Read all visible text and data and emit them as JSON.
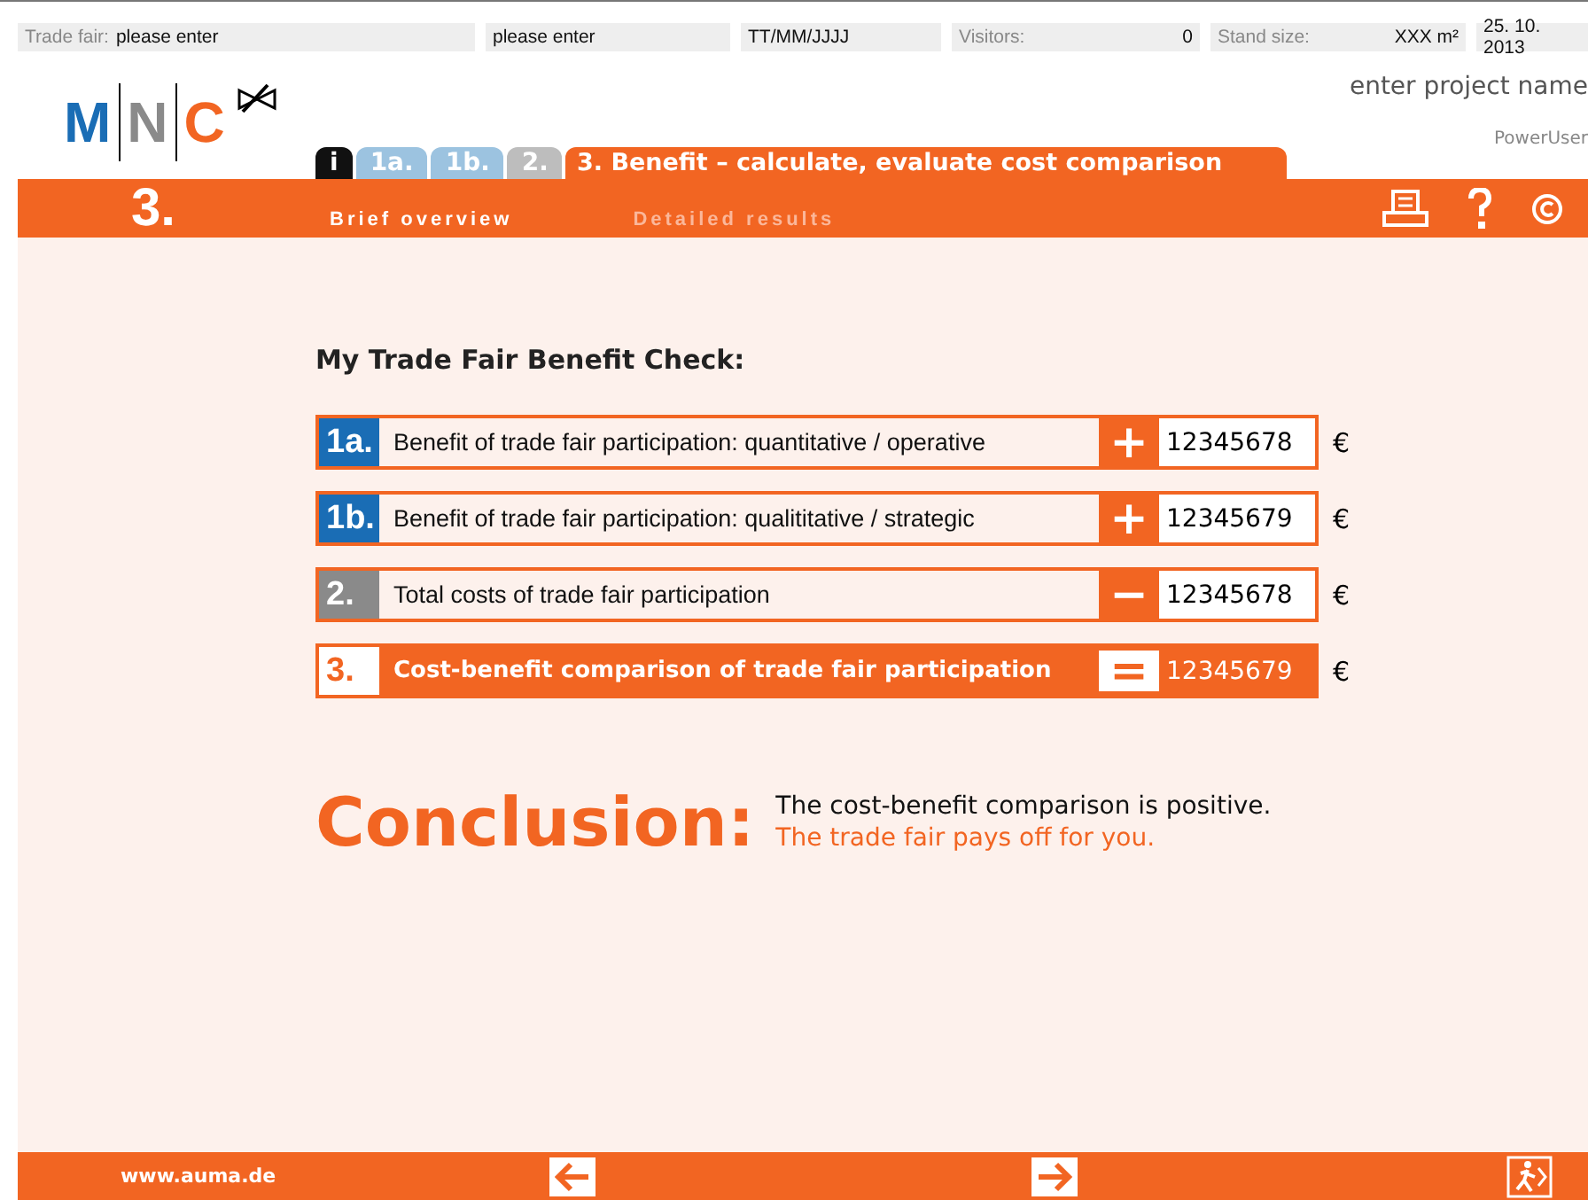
{
  "top_bar": [
    {
      "label": "Trade fair:",
      "value": "please enter"
    },
    {
      "value": "please enter"
    },
    {
      "value": "TT/MM/JJJJ"
    },
    {
      "label": "Visitors:",
      "value": "0"
    },
    {
      "label": "Stand size:",
      "value": "XXX m²"
    },
    {
      "value": "25. 10. 2013"
    }
  ],
  "logo": [
    {
      "letter": "M",
      "color": "#1a6db5"
    },
    {
      "letter": "N",
      "color": "#8a8a8a"
    },
    {
      "letter": "C",
      "color": "#f26522"
    }
  ],
  "project_name": "enter project name",
  "user": "PowerUser",
  "tabs": [
    {
      "label": "i",
      "color": "#111111",
      "selected": false
    },
    {
      "label": "1a.",
      "color": "#9cc3e0",
      "selected": false
    },
    {
      "label": "1b.",
      "color": "#9cc3e0",
      "selected": false
    },
    {
      "label": "2.",
      "color": "#bdbdbd",
      "selected": false
    },
    {
      "label": "3. Benefit – calculate, evaluate cost comparison",
      "color": "#f26522",
      "selected": true
    }
  ],
  "step": "3.",
  "subtabs": [
    {
      "label": "Brief overview",
      "selected": true
    },
    {
      "label": "Detailed results",
      "selected": false
    }
  ],
  "heading": "My Trade Fair Benefit Check:",
  "rows": [
    {
      "kind": "input",
      "badge": "1a.",
      "color": "#1a6db5",
      "label": "Benefit of trade fair participation: quantitative / operative",
      "operator": "+",
      "value": "12345678",
      "currency": "€"
    },
    {
      "kind": "input",
      "badge": "1b.",
      "color": "#1a6db5",
      "label": "Benefit of trade fair participation: qualititative / strategic",
      "operator": "+",
      "value": "12345679",
      "currency": "€"
    },
    {
      "kind": "input",
      "badge": "2.",
      "color": "#8a8a8a",
      "label": "Total costs of trade fair participation",
      "operator": "−",
      "value": "12345678",
      "currency": "€"
    },
    {
      "kind": "result",
      "badge": "3.",
      "color": "#f26522",
      "label": "Cost-benefit comparison of trade fair participation",
      "operator": "=",
      "value": "12345679",
      "currency": "€"
    }
  ],
  "conclusion": {
    "title": "Conclusion:",
    "line1": "The cost-benefit comparison is positive.",
    "line2": "The trade fair pays off for you."
  },
  "footer": {
    "link": "www.auma.de"
  }
}
